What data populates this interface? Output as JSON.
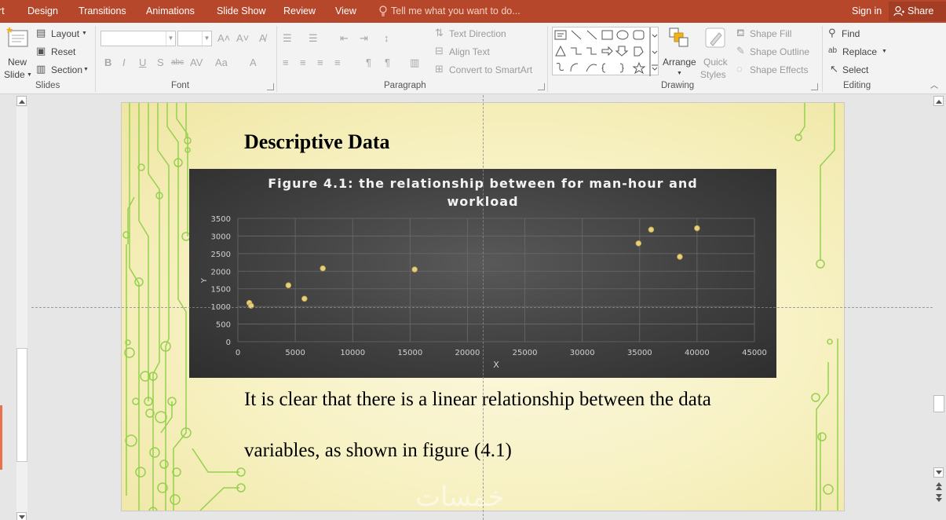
{
  "menu": {
    "tabs": [
      "rt",
      "Design",
      "Transitions",
      "Animations",
      "Slide Show",
      "Review",
      "View"
    ],
    "tell_me": "Tell me what you want to do...",
    "sign_in": "Sign in",
    "share": "Share"
  },
  "ribbon": {
    "slides": {
      "label": "Slides",
      "new_slide_line1": "New",
      "new_slide_line2": "Slide",
      "layout": "Layout",
      "reset": "Reset",
      "section": "Section"
    },
    "font": {
      "label": "Font",
      "font_name": "",
      "font_size": ""
    },
    "paragraph": {
      "label": "Paragraph",
      "text_direction": "Text Direction",
      "align_text": "Align Text",
      "convert_smartart": "Convert to SmartArt"
    },
    "drawing": {
      "label": "Drawing",
      "arrange": "Arrange",
      "quick_styles_line1": "Quick",
      "quick_styles_line2": "Styles",
      "shape_fill": "Shape Fill",
      "shape_outline": "Shape Outline",
      "shape_effects": "Shape Effects"
    },
    "editing": {
      "label": "Editing",
      "find": "Find",
      "replace": "Replace",
      "select": "Select"
    }
  },
  "slide": {
    "title": "Descriptive Data",
    "body_line1": "It is clear that there is a linear relationship between the data",
    "body_line2": "variables, as shown in figure (4.1)",
    "watermark": "خمسات"
  },
  "colors": {
    "menubar": "#b7472a",
    "chart_bg": "#404040",
    "point": "#e8cf7c",
    "circuit": "#93cf4e"
  },
  "chart_data": {
    "type": "scatter",
    "title_line1": "Figure 4.1: the relationship between for man-hour and",
    "title_line2": "workload",
    "xlabel": "X",
    "ylabel": "Y",
    "xlim": [
      0,
      45000
    ],
    "ylim": [
      0,
      3500
    ],
    "xticks": [
      0,
      5000,
      10000,
      15000,
      20000,
      25000,
      30000,
      35000,
      40000,
      45000
    ],
    "yticks": [
      0,
      500,
      1000,
      1500,
      2000,
      2500,
      3000,
      3500
    ],
    "grid": true,
    "legend": "none",
    "points": [
      {
        "x": 1000,
        "y": 1100
      },
      {
        "x": 1150,
        "y": 1020
      },
      {
        "x": 4400,
        "y": 1600
      },
      {
        "x": 5800,
        "y": 1220
      },
      {
        "x": 7400,
        "y": 2080
      },
      {
        "x": 15400,
        "y": 2050
      },
      {
        "x": 34900,
        "y": 2790
      },
      {
        "x": 36000,
        "y": 3180
      },
      {
        "x": 38500,
        "y": 2410
      },
      {
        "x": 40000,
        "y": 3220
      }
    ]
  }
}
